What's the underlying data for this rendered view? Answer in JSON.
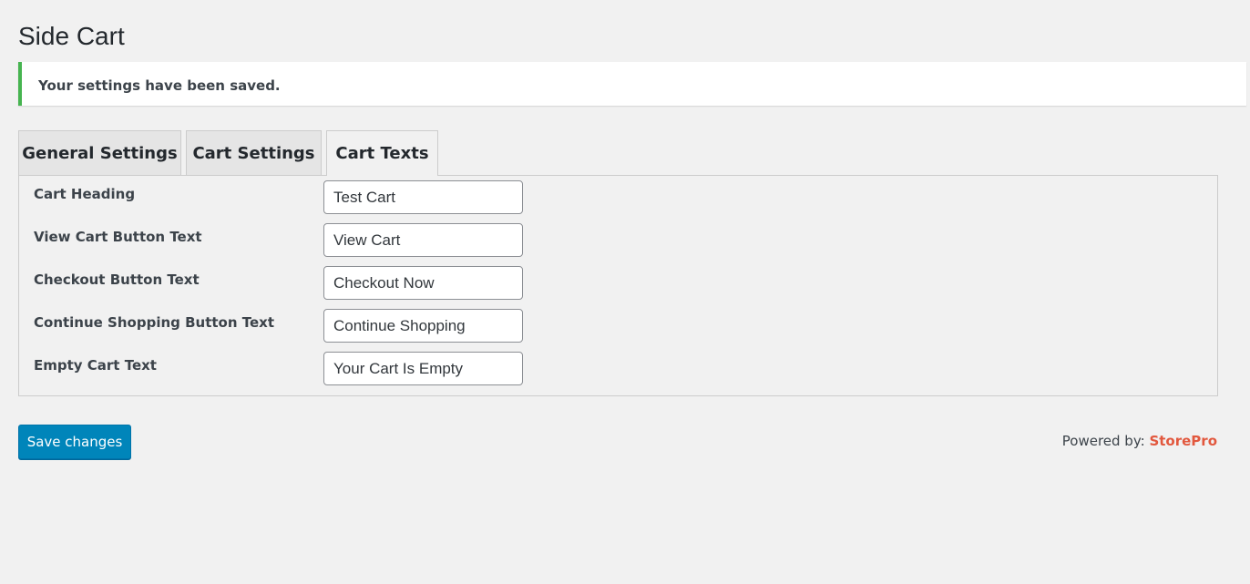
{
  "page": {
    "title": "Side Cart"
  },
  "notice": {
    "message": "Your settings have been saved.",
    "accent": "#46b450"
  },
  "tabs": [
    {
      "label": "General Settings"
    },
    {
      "label": "Cart Settings"
    },
    {
      "label": "Cart Texts"
    }
  ],
  "fields": [
    {
      "label": "Cart Heading",
      "value": "Test Cart"
    },
    {
      "label": "View Cart Button Text",
      "value": "View Cart"
    },
    {
      "label": "Checkout Button Text",
      "value": "Checkout Now"
    },
    {
      "label": "Continue Shopping Button Text",
      "value": "Continue Shopping"
    },
    {
      "label": "Empty Cart Text",
      "value": "Your Cart Is Empty"
    }
  ],
  "actions": {
    "save_label": "Save changes",
    "button_color": "#0085ba"
  },
  "footer": {
    "powered_prefix": "Powered by:",
    "brand": "StorePro",
    "brand_color": "#e2583e"
  }
}
